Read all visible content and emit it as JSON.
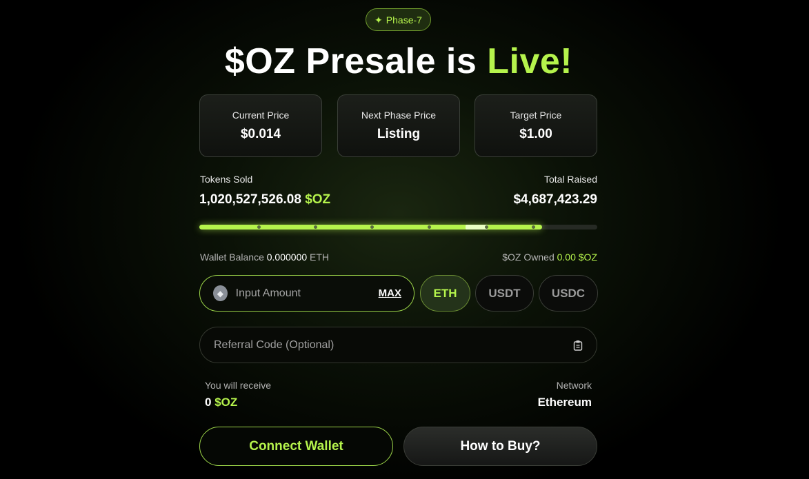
{
  "phase_badge": {
    "icon": "sparkle-icon",
    "label": "Phase-7"
  },
  "title": {
    "prefix": "$OZ Presale is ",
    "accent": "Live!"
  },
  "prices": [
    {
      "label": "Current Price",
      "value": "$0.014"
    },
    {
      "label": "Next Phase Price",
      "value": "Listing"
    },
    {
      "label": "Target Price",
      "value": "$1.00"
    }
  ],
  "stats": {
    "tokens_sold_label": "Tokens Sold",
    "tokens_sold_value": "1,020,527,526.08",
    "tokens_sold_unit": "$OZ",
    "total_raised_label": "Total Raised",
    "total_raised_value": "$4,687,423.29"
  },
  "progress": {
    "fraction": 0.862
  },
  "wallet": {
    "balance_label": "Wallet Balance",
    "balance_value": "0.000000",
    "balance_unit": "ETH",
    "owned_label": "$OZ Owned",
    "owned_value": "0.00 $OZ"
  },
  "purchase": {
    "amount_placeholder": "Input Amount",
    "max_label": "MAX",
    "currencies": [
      "ETH",
      "USDT",
      "USDC"
    ],
    "selected_currency": "ETH"
  },
  "referral": {
    "placeholder": "Referral Code (Optional)",
    "icon": "clipboard-icon"
  },
  "receive": {
    "label": "You will receive",
    "value": "0",
    "unit": "$OZ",
    "network_label": "Network",
    "network_value": "Ethereum"
  },
  "actions": {
    "connect_label": "Connect Wallet",
    "howto_label": "How to Buy?"
  },
  "colors": {
    "accent": "#b5f34c",
    "background": "#000000"
  }
}
